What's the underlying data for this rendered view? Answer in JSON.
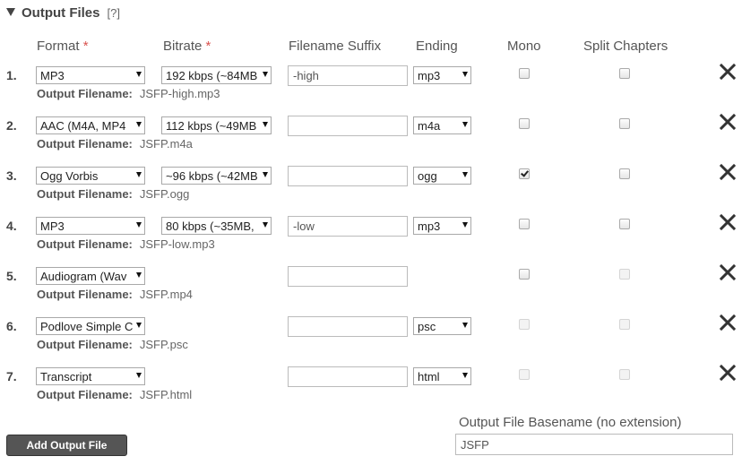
{
  "section": {
    "title": "Output Files",
    "help": "[?]"
  },
  "headers": {
    "format": "Format",
    "bitrate": "Bitrate",
    "required_mark": "*",
    "suffix": "Filename Suffix",
    "ending": "Ending",
    "mono": "Mono",
    "split": "Split Chapters"
  },
  "output_filename_label": "Output Filename:",
  "rows": [
    {
      "num": "1.",
      "format": "MP3",
      "bitrate": "192 kbps (~84MB",
      "suffix": "-high",
      "ending": "mp3",
      "mono": false,
      "mono_enabled": true,
      "split": false,
      "split_enabled": true,
      "output": "JSFP-high.mp3"
    },
    {
      "num": "2.",
      "format": "AAC (M4A, MP4",
      "bitrate": "112 kbps (~49MB",
      "suffix": "",
      "ending": "m4a",
      "mono": false,
      "mono_enabled": true,
      "split": false,
      "split_enabled": true,
      "output": "JSFP.m4a"
    },
    {
      "num": "3.",
      "format": "Ogg Vorbis",
      "bitrate": "~96 kbps (~42MB",
      "suffix": "",
      "ending": "ogg",
      "mono": true,
      "mono_enabled": true,
      "split": false,
      "split_enabled": true,
      "output": "JSFP.ogg"
    },
    {
      "num": "4.",
      "format": "MP3",
      "bitrate": "80 kbps (~35MB,",
      "suffix": "-low",
      "ending": "mp3",
      "mono": false,
      "mono_enabled": true,
      "split": false,
      "split_enabled": true,
      "output": "JSFP-low.mp3"
    },
    {
      "num": "5.",
      "format": "Audiogram (Wav",
      "bitrate": null,
      "suffix": "",
      "ending": null,
      "mono": false,
      "mono_enabled": true,
      "split": false,
      "split_enabled": false,
      "output": "JSFP.mp4"
    },
    {
      "num": "6.",
      "format": "Podlove Simple C",
      "bitrate": null,
      "suffix": "",
      "ending": "psc",
      "mono": false,
      "mono_enabled": false,
      "split": false,
      "split_enabled": false,
      "output": "JSFP.psc"
    },
    {
      "num": "7.",
      "format": "Transcript",
      "bitrate": null,
      "suffix": "",
      "ending": "html",
      "mono": false,
      "mono_enabled": false,
      "split": false,
      "split_enabled": false,
      "output": "JSFP.html"
    }
  ],
  "add_button": "Add Output File",
  "basename": {
    "label": "Output File Basename (no extension)",
    "value": "JSFP"
  },
  "icons": {
    "remove": "close-x-icon",
    "collapse": "triangle-down-icon"
  }
}
